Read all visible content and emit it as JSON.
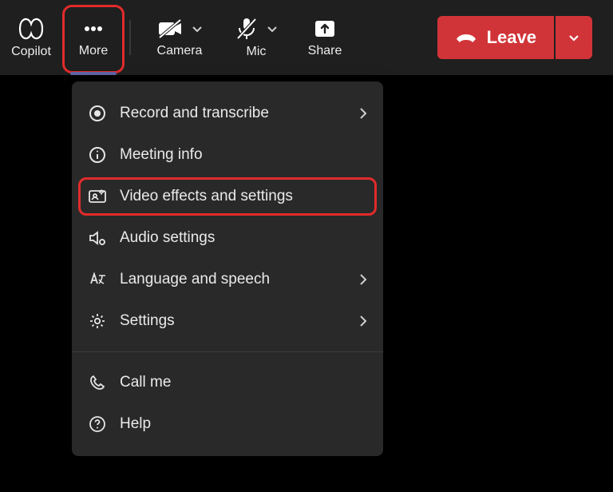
{
  "toolbar": {
    "copilot_label": "Copilot",
    "more_label": "More",
    "camera_label": "Camera",
    "mic_label": "Mic",
    "share_label": "Share",
    "leave_label": "Leave"
  },
  "menu": {
    "items": [
      {
        "label": "Record and transcribe",
        "has_submenu": true
      },
      {
        "label": "Meeting info",
        "has_submenu": false
      },
      {
        "label": "Video effects and settings",
        "has_submenu": false
      },
      {
        "label": "Audio settings",
        "has_submenu": false
      },
      {
        "label": "Language and speech",
        "has_submenu": true
      },
      {
        "label": "Settings",
        "has_submenu": true
      }
    ],
    "secondary": [
      {
        "label": "Call me"
      },
      {
        "label": "Help"
      }
    ]
  },
  "annotations": {
    "more_highlighted": true,
    "video_effects_highlighted": true
  }
}
